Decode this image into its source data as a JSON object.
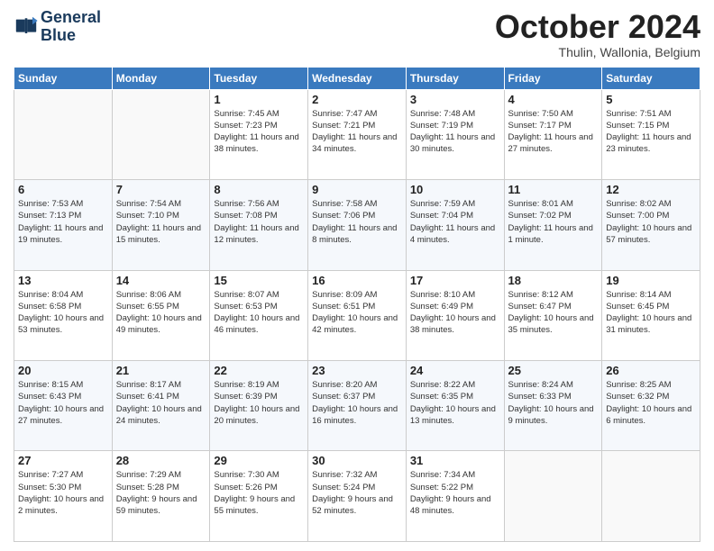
{
  "logo": {
    "line1": "General",
    "line2": "Blue"
  },
  "title": "October 2024",
  "location": "Thulin, Wallonia, Belgium",
  "days_of_week": [
    "Sunday",
    "Monday",
    "Tuesday",
    "Wednesday",
    "Thursday",
    "Friday",
    "Saturday"
  ],
  "weeks": [
    [
      {
        "day": "",
        "info": ""
      },
      {
        "day": "",
        "info": ""
      },
      {
        "day": "1",
        "info": "Sunrise: 7:45 AM\nSunset: 7:23 PM\nDaylight: 11 hours and 38 minutes."
      },
      {
        "day": "2",
        "info": "Sunrise: 7:47 AM\nSunset: 7:21 PM\nDaylight: 11 hours and 34 minutes."
      },
      {
        "day": "3",
        "info": "Sunrise: 7:48 AM\nSunset: 7:19 PM\nDaylight: 11 hours and 30 minutes."
      },
      {
        "day": "4",
        "info": "Sunrise: 7:50 AM\nSunset: 7:17 PM\nDaylight: 11 hours and 27 minutes."
      },
      {
        "day": "5",
        "info": "Sunrise: 7:51 AM\nSunset: 7:15 PM\nDaylight: 11 hours and 23 minutes."
      }
    ],
    [
      {
        "day": "6",
        "info": "Sunrise: 7:53 AM\nSunset: 7:13 PM\nDaylight: 11 hours and 19 minutes."
      },
      {
        "day": "7",
        "info": "Sunrise: 7:54 AM\nSunset: 7:10 PM\nDaylight: 11 hours and 15 minutes."
      },
      {
        "day": "8",
        "info": "Sunrise: 7:56 AM\nSunset: 7:08 PM\nDaylight: 11 hours and 12 minutes."
      },
      {
        "day": "9",
        "info": "Sunrise: 7:58 AM\nSunset: 7:06 PM\nDaylight: 11 hours and 8 minutes."
      },
      {
        "day": "10",
        "info": "Sunrise: 7:59 AM\nSunset: 7:04 PM\nDaylight: 11 hours and 4 minutes."
      },
      {
        "day": "11",
        "info": "Sunrise: 8:01 AM\nSunset: 7:02 PM\nDaylight: 11 hours and 1 minute."
      },
      {
        "day": "12",
        "info": "Sunrise: 8:02 AM\nSunset: 7:00 PM\nDaylight: 10 hours and 57 minutes."
      }
    ],
    [
      {
        "day": "13",
        "info": "Sunrise: 8:04 AM\nSunset: 6:58 PM\nDaylight: 10 hours and 53 minutes."
      },
      {
        "day": "14",
        "info": "Sunrise: 8:06 AM\nSunset: 6:55 PM\nDaylight: 10 hours and 49 minutes."
      },
      {
        "day": "15",
        "info": "Sunrise: 8:07 AM\nSunset: 6:53 PM\nDaylight: 10 hours and 46 minutes."
      },
      {
        "day": "16",
        "info": "Sunrise: 8:09 AM\nSunset: 6:51 PM\nDaylight: 10 hours and 42 minutes."
      },
      {
        "day": "17",
        "info": "Sunrise: 8:10 AM\nSunset: 6:49 PM\nDaylight: 10 hours and 38 minutes."
      },
      {
        "day": "18",
        "info": "Sunrise: 8:12 AM\nSunset: 6:47 PM\nDaylight: 10 hours and 35 minutes."
      },
      {
        "day": "19",
        "info": "Sunrise: 8:14 AM\nSunset: 6:45 PM\nDaylight: 10 hours and 31 minutes."
      }
    ],
    [
      {
        "day": "20",
        "info": "Sunrise: 8:15 AM\nSunset: 6:43 PM\nDaylight: 10 hours and 27 minutes."
      },
      {
        "day": "21",
        "info": "Sunrise: 8:17 AM\nSunset: 6:41 PM\nDaylight: 10 hours and 24 minutes."
      },
      {
        "day": "22",
        "info": "Sunrise: 8:19 AM\nSunset: 6:39 PM\nDaylight: 10 hours and 20 minutes."
      },
      {
        "day": "23",
        "info": "Sunrise: 8:20 AM\nSunset: 6:37 PM\nDaylight: 10 hours and 16 minutes."
      },
      {
        "day": "24",
        "info": "Sunrise: 8:22 AM\nSunset: 6:35 PM\nDaylight: 10 hours and 13 minutes."
      },
      {
        "day": "25",
        "info": "Sunrise: 8:24 AM\nSunset: 6:33 PM\nDaylight: 10 hours and 9 minutes."
      },
      {
        "day": "26",
        "info": "Sunrise: 8:25 AM\nSunset: 6:32 PM\nDaylight: 10 hours and 6 minutes."
      }
    ],
    [
      {
        "day": "27",
        "info": "Sunrise: 7:27 AM\nSunset: 5:30 PM\nDaylight: 10 hours and 2 minutes."
      },
      {
        "day": "28",
        "info": "Sunrise: 7:29 AM\nSunset: 5:28 PM\nDaylight: 9 hours and 59 minutes."
      },
      {
        "day": "29",
        "info": "Sunrise: 7:30 AM\nSunset: 5:26 PM\nDaylight: 9 hours and 55 minutes."
      },
      {
        "day": "30",
        "info": "Sunrise: 7:32 AM\nSunset: 5:24 PM\nDaylight: 9 hours and 52 minutes."
      },
      {
        "day": "31",
        "info": "Sunrise: 7:34 AM\nSunset: 5:22 PM\nDaylight: 9 hours and 48 minutes."
      },
      {
        "day": "",
        "info": ""
      },
      {
        "day": "",
        "info": ""
      }
    ]
  ]
}
